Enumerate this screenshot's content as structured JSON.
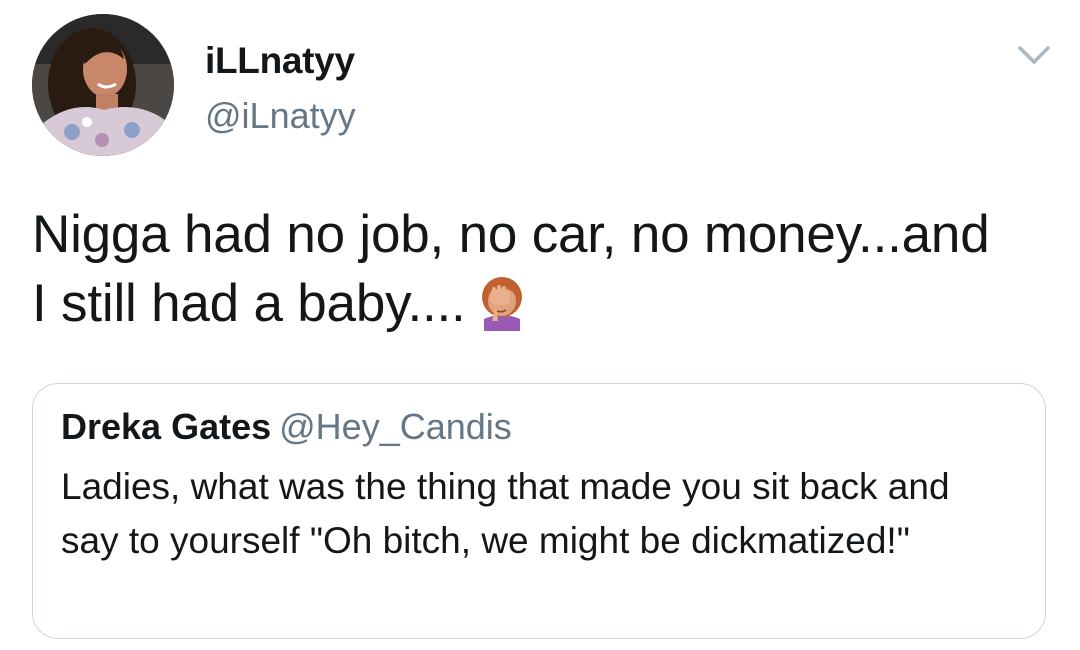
{
  "tweet": {
    "author": {
      "display_name": "iLLnatyy",
      "handle": "@iLnatyy",
      "avatar_icon": "profile-photo"
    },
    "menu_icon": "chevron-down-icon",
    "text": "Nigga had no job, no car, no money...and I still had a baby....",
    "emoji": "woman-facepalming-emoji",
    "quoted_tweet": {
      "author_name": "Dreka Gates",
      "author_handle": "@Hey_Candis",
      "text": "Ladies, what was the thing that made you sit back and say to yourself \"Oh bitch, we might be dickmatized!\""
    }
  },
  "colors": {
    "text_primary": "#14171a",
    "text_secondary": "#657786",
    "border": "#ccd6dd",
    "chevron": "#aab8c2"
  }
}
